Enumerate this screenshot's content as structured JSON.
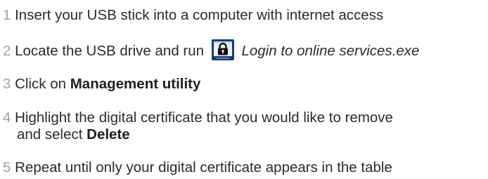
{
  "steps": [
    {
      "number": "1",
      "text": "Insert your USB stick into a computer with internet access"
    },
    {
      "number": "2",
      "text_before": "Locate the USB drive and run",
      "icon": "lock-app-icon",
      "file_name": "Login to online services.exe"
    },
    {
      "number": "3",
      "text_before": "Click on",
      "emphasis": "Management utility"
    },
    {
      "number": "4",
      "line1": "Highlight the digital certificate that you would like to remove",
      "line2_before": "and select",
      "emphasis": "Delete"
    },
    {
      "number": "5",
      "text": "Repeat until only your digital certificate appears in the table"
    }
  ],
  "colors": {
    "step_number": "#a3a3a3",
    "body_text": "#2b2b2b",
    "icon_frame": "#1a3d6e"
  }
}
